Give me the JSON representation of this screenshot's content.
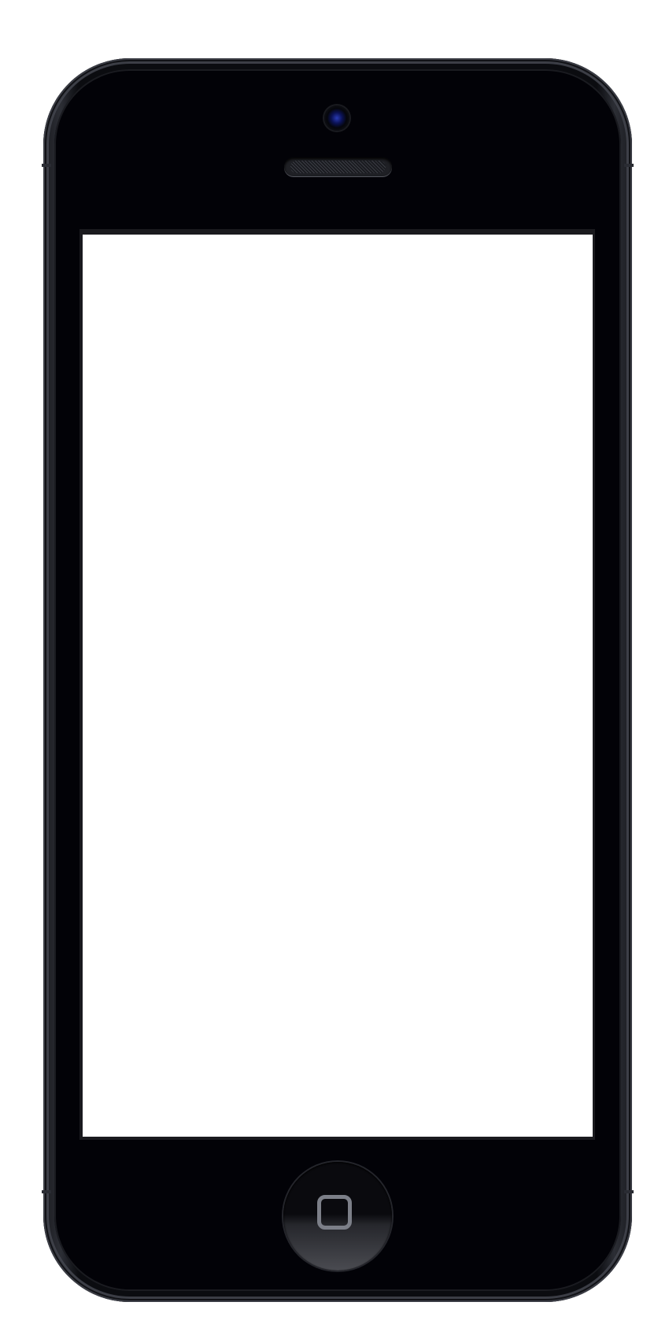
{
  "device": {
    "frame_color": "#0b0c10",
    "screen_color": "#ffffff",
    "camera_lens_color": "#2a3bb4",
    "home_button_icon": "rounded-square-icon"
  }
}
